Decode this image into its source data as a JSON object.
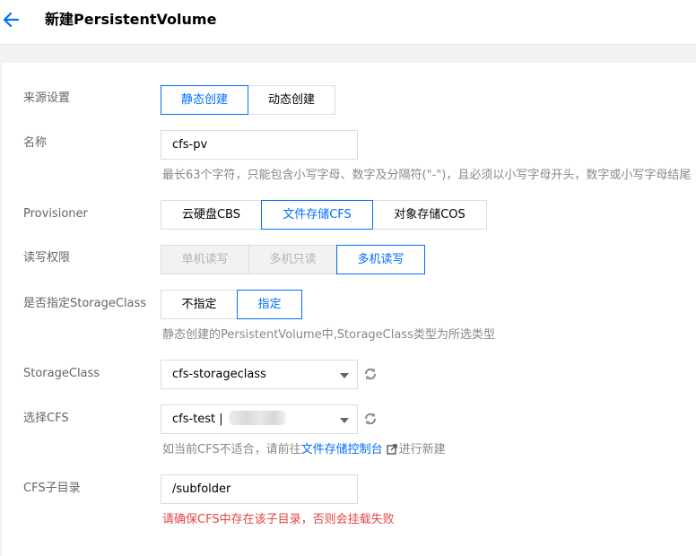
{
  "header": {
    "title": "新建PersistentVolume"
  },
  "form": {
    "source": {
      "label": "来源设置",
      "options": [
        "静态创建",
        "动态创建"
      ],
      "selected": "静态创建"
    },
    "name": {
      "label": "名称",
      "value": "cfs-pv",
      "hint": "最长63个字符，只能包含小写字母、数字及分隔符(\"-\")，且必须以小写字母开头，数字或小写字母结尾"
    },
    "provisioner": {
      "label": "Provisioner",
      "options": [
        "云硬盘CBS",
        "文件存储CFS",
        "对象存储COS"
      ],
      "selected": "文件存储CFS"
    },
    "access": {
      "label": "读写权限",
      "options": [
        "单机读写",
        "多机只读",
        "多机读写"
      ],
      "selected": "多机读写"
    },
    "storageclass_flag": {
      "label": "是否指定StorageClass",
      "options": [
        "不指定",
        "指定"
      ],
      "selected": "指定",
      "hint": "静态创建的PersistentVolume中,StorageClass类型为所选类型"
    },
    "storageclass": {
      "label": "StorageClass",
      "value": "cfs-storageclass"
    },
    "cfs": {
      "label": "选择CFS",
      "value": "cfs-test |",
      "hint_before": "如当前CFS不适合，请前往",
      "hint_link": "文件存储控制台",
      "hint_after": "进行新建"
    },
    "subdir": {
      "label": "CFS子目录",
      "value": "/subfolder",
      "hint": "请确保CFS中存在该子目录，否则会挂载失败"
    }
  },
  "colors": {
    "accent": "#006eff",
    "error": "#e54545"
  }
}
